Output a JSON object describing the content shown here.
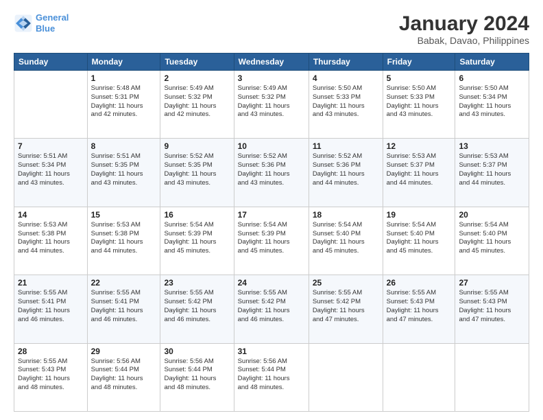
{
  "header": {
    "logo_line1": "General",
    "logo_line2": "Blue",
    "title": "January 2024",
    "subtitle": "Babak, Davao, Philippines"
  },
  "columns": [
    "Sunday",
    "Monday",
    "Tuesday",
    "Wednesday",
    "Thursday",
    "Friday",
    "Saturday"
  ],
  "weeks": [
    [
      {
        "day": "",
        "info": ""
      },
      {
        "day": "1",
        "info": "Sunrise: 5:48 AM\nSunset: 5:31 PM\nDaylight: 11 hours\nand 42 minutes."
      },
      {
        "day": "2",
        "info": "Sunrise: 5:49 AM\nSunset: 5:32 PM\nDaylight: 11 hours\nand 42 minutes."
      },
      {
        "day": "3",
        "info": "Sunrise: 5:49 AM\nSunset: 5:32 PM\nDaylight: 11 hours\nand 43 minutes."
      },
      {
        "day": "4",
        "info": "Sunrise: 5:50 AM\nSunset: 5:33 PM\nDaylight: 11 hours\nand 43 minutes."
      },
      {
        "day": "5",
        "info": "Sunrise: 5:50 AM\nSunset: 5:33 PM\nDaylight: 11 hours\nand 43 minutes."
      },
      {
        "day": "6",
        "info": "Sunrise: 5:50 AM\nSunset: 5:34 PM\nDaylight: 11 hours\nand 43 minutes."
      }
    ],
    [
      {
        "day": "7",
        "info": "Sunrise: 5:51 AM\nSunset: 5:34 PM\nDaylight: 11 hours\nand 43 minutes."
      },
      {
        "day": "8",
        "info": "Sunrise: 5:51 AM\nSunset: 5:35 PM\nDaylight: 11 hours\nand 43 minutes."
      },
      {
        "day": "9",
        "info": "Sunrise: 5:52 AM\nSunset: 5:35 PM\nDaylight: 11 hours\nand 43 minutes."
      },
      {
        "day": "10",
        "info": "Sunrise: 5:52 AM\nSunset: 5:36 PM\nDaylight: 11 hours\nand 43 minutes."
      },
      {
        "day": "11",
        "info": "Sunrise: 5:52 AM\nSunset: 5:36 PM\nDaylight: 11 hours\nand 44 minutes."
      },
      {
        "day": "12",
        "info": "Sunrise: 5:53 AM\nSunset: 5:37 PM\nDaylight: 11 hours\nand 44 minutes."
      },
      {
        "day": "13",
        "info": "Sunrise: 5:53 AM\nSunset: 5:37 PM\nDaylight: 11 hours\nand 44 minutes."
      }
    ],
    [
      {
        "day": "14",
        "info": "Sunrise: 5:53 AM\nSunset: 5:38 PM\nDaylight: 11 hours\nand 44 minutes."
      },
      {
        "day": "15",
        "info": "Sunrise: 5:53 AM\nSunset: 5:38 PM\nDaylight: 11 hours\nand 44 minutes."
      },
      {
        "day": "16",
        "info": "Sunrise: 5:54 AM\nSunset: 5:39 PM\nDaylight: 11 hours\nand 45 minutes."
      },
      {
        "day": "17",
        "info": "Sunrise: 5:54 AM\nSunset: 5:39 PM\nDaylight: 11 hours\nand 45 minutes."
      },
      {
        "day": "18",
        "info": "Sunrise: 5:54 AM\nSunset: 5:40 PM\nDaylight: 11 hours\nand 45 minutes."
      },
      {
        "day": "19",
        "info": "Sunrise: 5:54 AM\nSunset: 5:40 PM\nDaylight: 11 hours\nand 45 minutes."
      },
      {
        "day": "20",
        "info": "Sunrise: 5:54 AM\nSunset: 5:40 PM\nDaylight: 11 hours\nand 45 minutes."
      }
    ],
    [
      {
        "day": "21",
        "info": "Sunrise: 5:55 AM\nSunset: 5:41 PM\nDaylight: 11 hours\nand 46 minutes."
      },
      {
        "day": "22",
        "info": "Sunrise: 5:55 AM\nSunset: 5:41 PM\nDaylight: 11 hours\nand 46 minutes."
      },
      {
        "day": "23",
        "info": "Sunrise: 5:55 AM\nSunset: 5:42 PM\nDaylight: 11 hours\nand 46 minutes."
      },
      {
        "day": "24",
        "info": "Sunrise: 5:55 AM\nSunset: 5:42 PM\nDaylight: 11 hours\nand 46 minutes."
      },
      {
        "day": "25",
        "info": "Sunrise: 5:55 AM\nSunset: 5:42 PM\nDaylight: 11 hours\nand 47 minutes."
      },
      {
        "day": "26",
        "info": "Sunrise: 5:55 AM\nSunset: 5:43 PM\nDaylight: 11 hours\nand 47 minutes."
      },
      {
        "day": "27",
        "info": "Sunrise: 5:55 AM\nSunset: 5:43 PM\nDaylight: 11 hours\nand 47 minutes."
      }
    ],
    [
      {
        "day": "28",
        "info": "Sunrise: 5:55 AM\nSunset: 5:43 PM\nDaylight: 11 hours\nand 48 minutes."
      },
      {
        "day": "29",
        "info": "Sunrise: 5:56 AM\nSunset: 5:44 PM\nDaylight: 11 hours\nand 48 minutes."
      },
      {
        "day": "30",
        "info": "Sunrise: 5:56 AM\nSunset: 5:44 PM\nDaylight: 11 hours\nand 48 minutes."
      },
      {
        "day": "31",
        "info": "Sunrise: 5:56 AM\nSunset: 5:44 PM\nDaylight: 11 hours\nand 48 minutes."
      },
      {
        "day": "",
        "info": ""
      },
      {
        "day": "",
        "info": ""
      },
      {
        "day": "",
        "info": ""
      }
    ]
  ]
}
